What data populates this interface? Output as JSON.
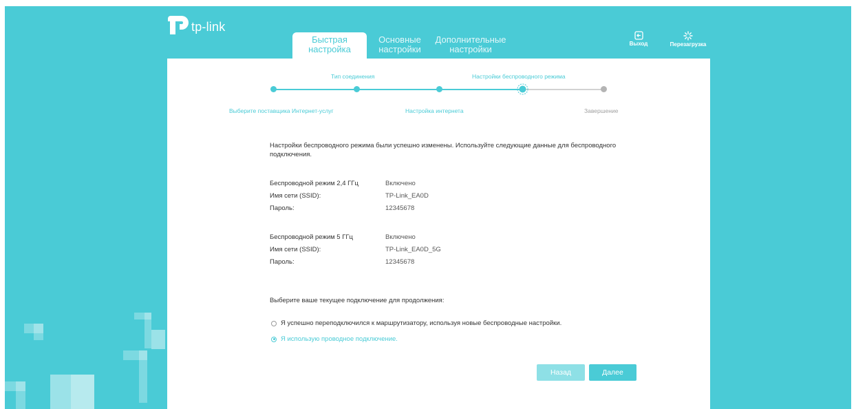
{
  "brand": {
    "name": "tp-link",
    "accent": "#4acbd6",
    "logo_icon": "tp-link-logo-icon"
  },
  "tabs": [
    {
      "line1": "Быстрая",
      "line2": "настройка",
      "active": true
    },
    {
      "line1": "Основные",
      "line2": "настройки",
      "active": false
    },
    {
      "line1": "Дополнительные",
      "line2": "настройки",
      "active": false
    }
  ],
  "header": {
    "logout_label": "Выход",
    "logout_icon": "logout-icon",
    "reboot_label": "Перезагрузка",
    "reboot_icon": "reboot-spinner-icon"
  },
  "stepper": {
    "top_labels": [
      "Тип соединения",
      "Настройки беспроводного режима"
    ],
    "bottom_labels": [
      "Выберите поставщика Интернет-услуг",
      "Настройка интернета",
      "Завершение"
    ],
    "current_step": 5,
    "total_steps": 6
  },
  "message": {
    "line1": "Настройки беспроводного режима были успешно изменены. Используйте следующие данные для беспроводного",
    "line2": "подключения."
  },
  "wireless_24": {
    "mode_label": "Беспроводной режим 2,4 ГГц",
    "mode_value": "Включено",
    "ssid_label": "Имя сети (SSID):",
    "ssid_value": "TP-Link_EA0D",
    "password_label": "Пароль:",
    "password_value": "12345678"
  },
  "wireless_5": {
    "mode_label": "Беспроводной режим 5 ГГц",
    "mode_value": "Включено",
    "ssid_label": "Имя сети (SSID):",
    "ssid_value": "TP-Link_EA0D_5G",
    "password_label": "Пароль:",
    "password_value": "12345678"
  },
  "connection": {
    "prompt": "Выберите ваше текущее подключение для продолжения:",
    "options": [
      {
        "label": "Я успешно переподключился к маршрутизатору, используя новые беспроводные настройки.",
        "selected": false
      },
      {
        "label": "Я использую проводное подключение.",
        "selected": true
      }
    ]
  },
  "buttons": {
    "back": "Назад",
    "next": "Далее"
  }
}
